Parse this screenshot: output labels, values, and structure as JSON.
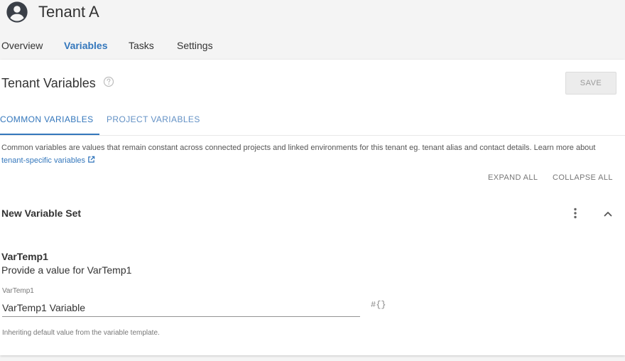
{
  "header": {
    "title": "Tenant A",
    "avatar_icon": "account-circle-icon"
  },
  "nav": {
    "tabs": [
      {
        "label": "Overview",
        "active": false
      },
      {
        "label": "Variables",
        "active": true
      },
      {
        "label": "Tasks",
        "active": false
      },
      {
        "label": "Settings",
        "active": false
      }
    ]
  },
  "main": {
    "title": "Tenant Variables",
    "help_icon": "help-circle-icon",
    "save_label": "SAVE",
    "subtabs": [
      {
        "label": "COMMON VARIABLES",
        "active": true
      },
      {
        "label": "PROJECT VARIABLES",
        "active": false
      }
    ],
    "description": "Common variables are values that remain constant across connected projects and linked environments for this tenant eg. tenant alias and contact details. Learn more about",
    "description_link": "tenant-specific variables",
    "expand_all": "EXPAND ALL",
    "collapse_all": "COLLAPSE ALL",
    "variable_set": {
      "title": "New Variable Set",
      "variable": {
        "name": "VarTemp1",
        "prompt": "Provide a value for VarTemp1",
        "field_label": "VarTemp1",
        "value": "VarTemp1 Variable",
        "insert_symbol": "#{}",
        "helper": "Inheriting default value from the variable template."
      }
    }
  },
  "colors": {
    "accent": "#3477bc",
    "background": "#f4f4f4",
    "card": "#ffffff"
  }
}
